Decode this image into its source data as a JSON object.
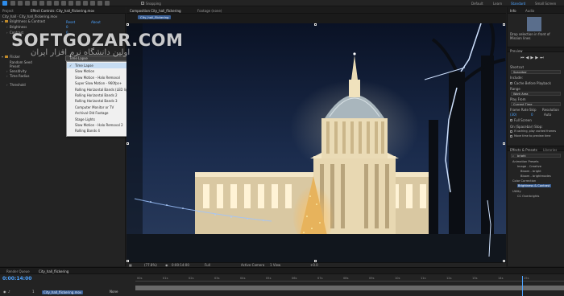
{
  "toolbar": {
    "snapping": "Snapping",
    "workspaces": [
      "Default",
      "Learn",
      "Standard",
      "Small Screen"
    ]
  },
  "left_panel": {
    "tabs": [
      "Project",
      "Effect Controls: City_hall_flickering.mov"
    ],
    "col_reset": "Reset",
    "col_about": "About",
    "breadcrumb": "City_hall · City_hall_flickering.mov",
    "rows": [
      {
        "label": "Brightness & Contrast"
      },
      {
        "label": "Brightness",
        "value": "0"
      },
      {
        "label": "Contrast",
        "value": "0"
      },
      {
        "label": "Flicker",
        "value": ""
      },
      {
        "label": "Random Seed"
      },
      {
        "label": "Preset",
        "value": "Time Lapse"
      },
      {
        "label": "Sensitivity"
      },
      {
        "label": "Time Radius"
      },
      {
        "label": "Threshold"
      }
    ],
    "dropdown_value": "Time Lapse"
  },
  "dropdown_menu": {
    "selected_index": 0,
    "items": [
      "Time Lapse",
      "Slow Motion",
      "Slow Motion - Halo Removal",
      "Super Slow Motion - 960fps+",
      "Rolling Horizontal Bands (LED lights)",
      "Rolling Horizontal Bands 2",
      "Rolling Horizontal Bands 3",
      "Computer Monitor or TV",
      "Archival Old Footage",
      "Stage Lights",
      "Slow Motion - Halo Removal 2",
      "Rolling Bands 4"
    ]
  },
  "composition": {
    "tab_label": "Composition City_hall_flickering",
    "footage_tab": "Footage (none)",
    "sub_tab": "City_hall_flickering",
    "footer": {
      "zoom": "(77.8%)",
      "timecode": "0:00:14:00",
      "resolution": "Full",
      "camera": "Active Camera",
      "views": "1 View",
      "offset": "+0.0"
    }
  },
  "right_panel": {
    "tabs": [
      "Info",
      "Audio"
    ],
    "info_note": "Drop selection in front of Mission lines",
    "preview_title": "Preview",
    "shortcut_label": "Shortcut",
    "shortcut_value": "Spacebar",
    "include_label": "Include:",
    "cache_label": "Cache Before Playback",
    "range_label": "Range",
    "range_value": "Work Area",
    "play_from_label": "Play From",
    "play_from_value": "Current Time",
    "frame_rate_label": "Frame Rate",
    "skip_label": "Skip",
    "resolution_label": "Resolution",
    "frame_rate_value": "(30)",
    "skip_value": "0",
    "resolution_value": "Auto",
    "fullscreen_label": "Full Screen",
    "stop_label": "On (Spacebar) Stop:",
    "stop_opt1": "If caching, play cached frames",
    "stop_opt2": "Move time to preview time",
    "effects_title": "Effects & Presets",
    "libraries_title": "Libraries",
    "search_value": "bright",
    "tree": [
      "Animation Presets",
      "Image - Creative",
      "Bloom - bright",
      "Bloom - brightmodes",
      "Color Correction",
      "Brightness & Contrast",
      "Utility",
      "CC Overbrights"
    ]
  },
  "timeline": {
    "tabs": [
      "Render Queue",
      "City_hall_flickering"
    ],
    "timecode": "0:00:14:00",
    "layer_number": "1",
    "layer_name": "City_hall_flickering.mov",
    "mode": "None",
    "ticks": [
      "00s",
      "01s",
      "02s",
      "03s",
      "04s",
      "05s",
      "06s",
      "07s",
      "08s",
      "09s",
      "10s",
      "11s",
      "12s",
      "13s",
      "14s",
      "15s"
    ]
  },
  "watermark": {
    "text": "SOFTGOZAR.COM",
    "subtext": "اولین دانشگاه نرم افزار ایران"
  },
  "colors": {
    "accent": "#4da3ff",
    "panel": "#232323",
    "menu_bg": "#f0f0f0",
    "menu_selected": "#c6dcf2"
  }
}
